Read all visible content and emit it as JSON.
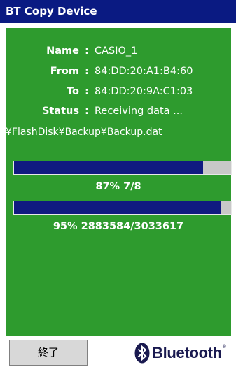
{
  "window": {
    "title": "BT Copy Device"
  },
  "info": {
    "rows": [
      {
        "label": "Name",
        "value": "CASIO_1"
      },
      {
        "label": "From",
        "value": "84:DD:20:A1:B4:60"
      },
      {
        "label": "To",
        "value": "84:DD:20:9A:C1:03"
      },
      {
        "label": "Status",
        "value": "Receiving data ..."
      }
    ],
    "colon": ":",
    "path": "¥FlashDisk¥Backup¥Backup.dat"
  },
  "progress": {
    "file_fraction": 0.87,
    "file_text": "87% 7/8",
    "bytes_fraction": 0.95,
    "bytes_text": "95% 2883584/3033617"
  },
  "footer": {
    "button_label": "終了",
    "logo_text": "Bluetooth",
    "logo_mark": "®",
    "logo_icon": "bluetooth-icon"
  },
  "colors": {
    "title_bar": "#0a1a82",
    "panel": "#2e9b2e",
    "progress_fill": "#101a80"
  }
}
